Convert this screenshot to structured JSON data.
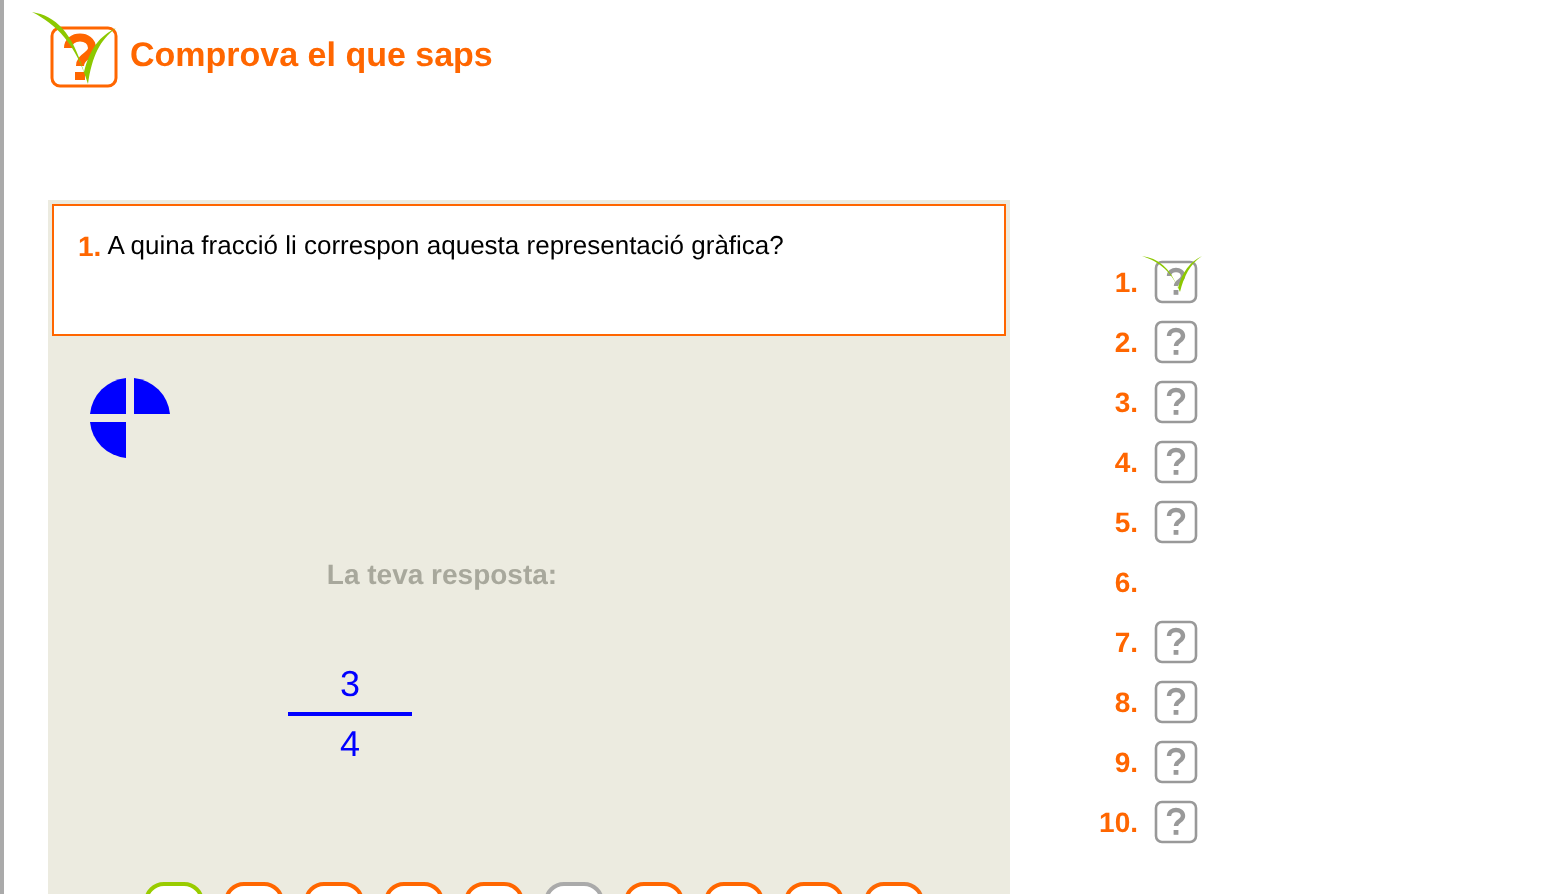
{
  "header": {
    "title": "Comprova el que saps"
  },
  "question": {
    "number": "1.",
    "text": "A quina fracció li correspon aquesta representació gràfica?"
  },
  "answer": {
    "label": "La teva resposta:",
    "numerator": "3",
    "denominator": "4"
  },
  "progress": [
    {
      "number": "1.",
      "kind": "correct"
    },
    {
      "number": "2.",
      "kind": "pending"
    },
    {
      "number": "3.",
      "kind": "pending"
    },
    {
      "number": "4.",
      "kind": "pending"
    },
    {
      "number": "5.",
      "kind": "pending"
    },
    {
      "number": "6.",
      "kind": "current"
    },
    {
      "number": "7.",
      "kind": "pending"
    },
    {
      "number": "8.",
      "kind": "pending"
    },
    {
      "number": "9.",
      "kind": "pending"
    },
    {
      "number": "10.",
      "kind": "pending"
    }
  ],
  "nav_dots": [
    {
      "color": "#99cc00"
    },
    {
      "color": "#ff6600"
    },
    {
      "color": "#ff6600"
    },
    {
      "color": "#ff6600"
    },
    {
      "color": "#ff6600"
    },
    {
      "color": "#aaaaaa"
    },
    {
      "color": "#ff6600"
    },
    {
      "color": "#ff6600"
    },
    {
      "color": "#ff6600"
    },
    {
      "color": "#ff6600"
    }
  ]
}
